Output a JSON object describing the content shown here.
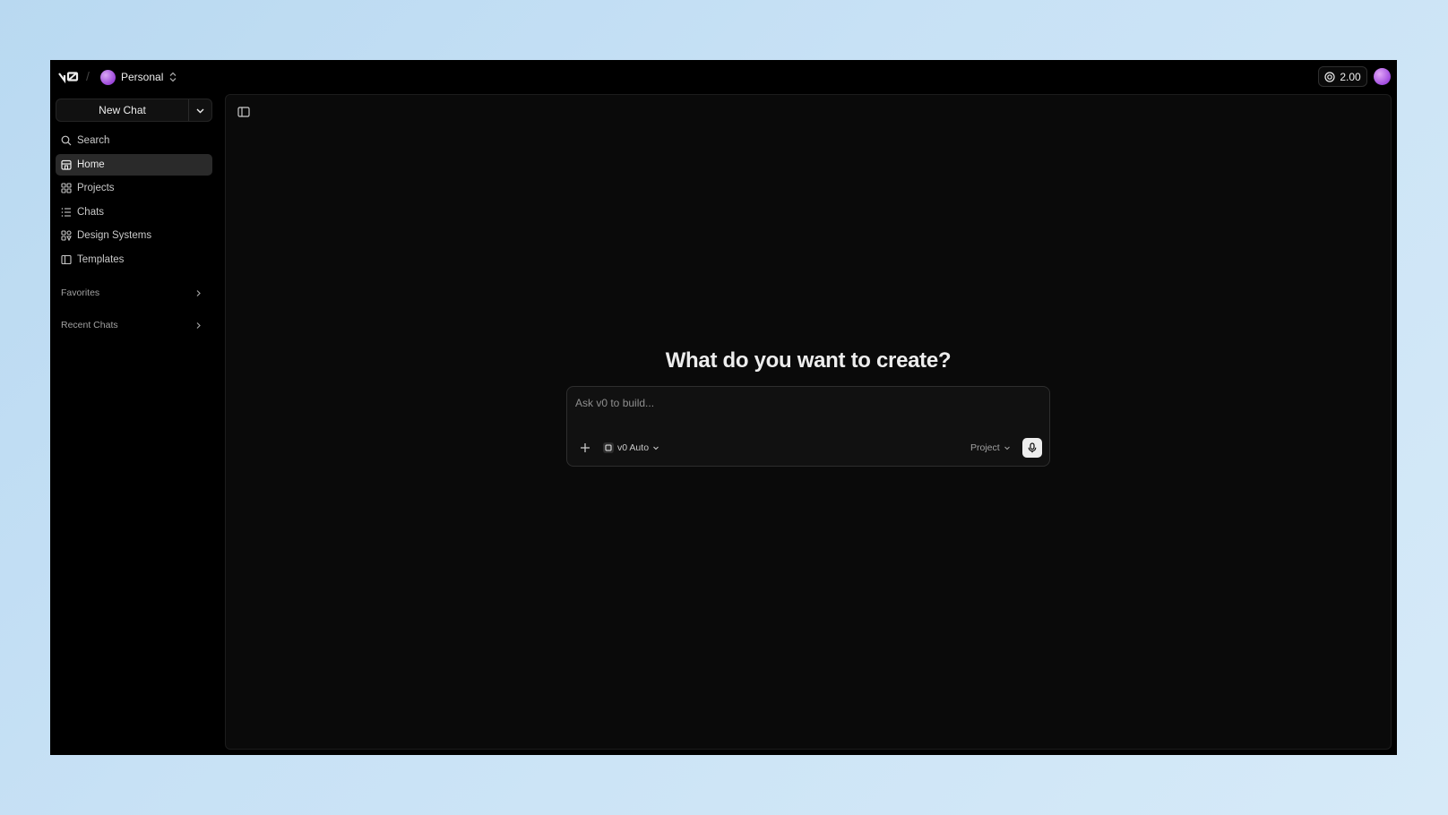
{
  "header": {
    "logo_text": "v0",
    "separator": "/",
    "workspace": "Personal",
    "credits": "2.00"
  },
  "sidebar": {
    "new_chat_label": "New Chat",
    "items": [
      {
        "label": "Search",
        "icon": "search-icon"
      },
      {
        "label": "Home",
        "icon": "home-icon",
        "active": true
      },
      {
        "label": "Projects",
        "icon": "grid-icon"
      },
      {
        "label": "Chats",
        "icon": "list-icon"
      },
      {
        "label": "Design Systems",
        "icon": "design-systems-icon"
      },
      {
        "label": "Templates",
        "icon": "template-icon"
      }
    ],
    "sections": [
      {
        "label": "Favorites"
      },
      {
        "label": "Recent Chats"
      }
    ]
  },
  "main": {
    "headline": "What do you want to create?",
    "composer": {
      "placeholder": "Ask v0 to build...",
      "model": "v0 Auto",
      "project": "Project"
    }
  },
  "colors": {
    "window_bg": "#000000",
    "main_bg": "#0a0a0a",
    "active_item_bg": "#2a2a2a",
    "text": "#ededed",
    "avatar_purple": "#a24de0"
  }
}
